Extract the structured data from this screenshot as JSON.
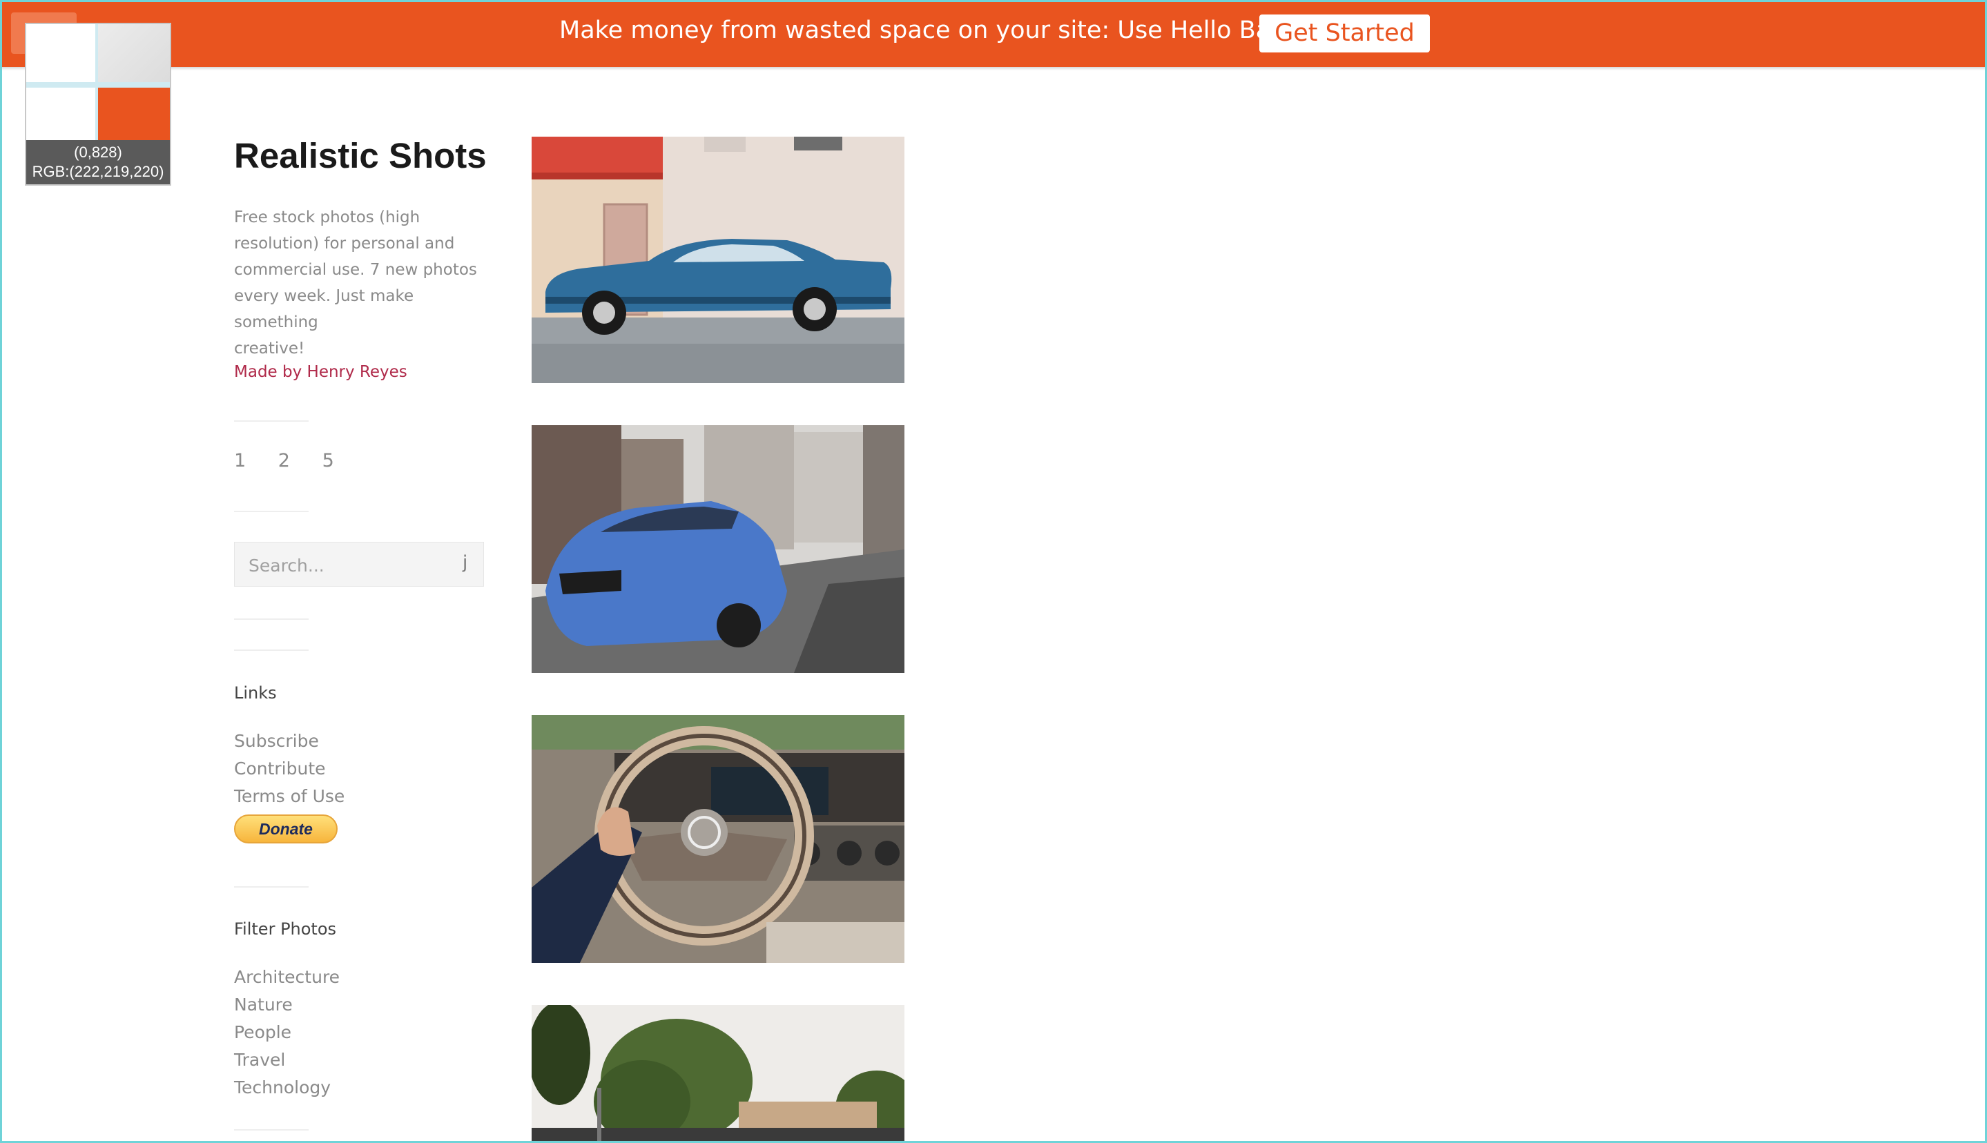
{
  "hellobar": {
    "message": "Make money from wasted space on your site: Use Hello Bar.",
    "button_label": "Get Started"
  },
  "loupe": {
    "coords": "(0,828)",
    "rgb": "RGB:(222,219,220)"
  },
  "sidebar": {
    "title": "Realistic Shots",
    "tagline_lines": [
      "Free stock photos (high",
      "resolution) for personal and",
      "commercial use. 7 new photos",
      "every week. Just make something",
      "creative!"
    ],
    "author": "Made by Henry Reyes",
    "pages": [
      "1",
      "2",
      "5"
    ],
    "search": {
      "placeholder": "Search...",
      "icon_glyph": "j"
    },
    "links_title": "Links",
    "links": [
      "Subscribe",
      "Contribute",
      "Terms of Use"
    ],
    "donate_label": "Donate",
    "filter_title": "Filter Photos",
    "filters": [
      "Architecture",
      "Nature",
      "People",
      "Travel",
      "Technology"
    ]
  },
  "photos": [
    {
      "icon": "vintage-blue-car-photo"
    },
    {
      "icon": "blue-bmw-city-street-photo"
    },
    {
      "icon": "steering-wheel-interior-photo"
    },
    {
      "icon": "trees-landscape-photo"
    }
  ],
  "colors": {
    "hellobar": "#e9541f",
    "author_link": "#b02a4a",
    "frame_border": "#6fd3d8"
  }
}
